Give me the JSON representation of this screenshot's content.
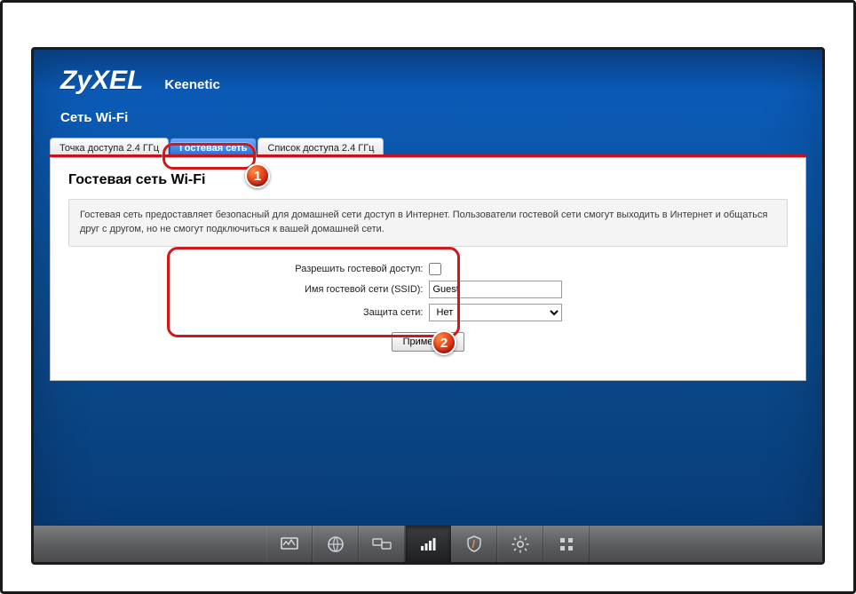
{
  "brand": {
    "logo": "ZyXEL",
    "model": "Keenetic"
  },
  "page": {
    "subtitle": "Сеть Wi-Fi"
  },
  "tabs": [
    {
      "label": "Точка доступа 2.4 ГГц"
    },
    {
      "label": "Гостевая сеть"
    },
    {
      "label": "Список доступа 2.4 ГГц"
    }
  ],
  "panel": {
    "title": "Гостевая сеть Wi-Fi",
    "description": "Гостевая сеть предоставляет безопасный для домашней сети доступ в Интернет. Пользователи гостевой сети смогут выходить в Интернет и общаться друг с другом, но не смогут подключиться к вашей домашней сети."
  },
  "form": {
    "allow_label": "Разрешить гостевой доступ:",
    "ssid_label": "Имя гостевой сети (SSID):",
    "ssid_value": "Guest",
    "security_label": "Защита сети:",
    "security_value": "Нет",
    "apply_label": "Применить"
  },
  "callouts": {
    "one": "1",
    "two": "2"
  },
  "toolbar_icons": [
    "monitor-icon",
    "globe-icon",
    "computers-icon",
    "wifi-bars-icon",
    "shield-icon",
    "gear-icon",
    "apps-icon"
  ]
}
